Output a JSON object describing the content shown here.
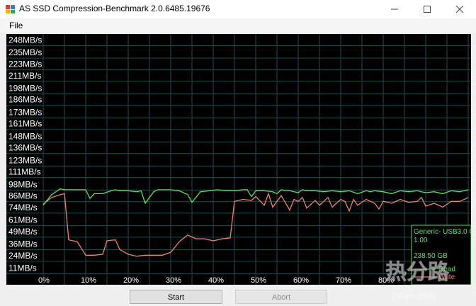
{
  "window": {
    "title": "AS SSD Compression-Benchmark 2.0.6485.19676",
    "minimize_icon": "minimize-icon",
    "maximize_icon": "maximize-icon",
    "close_icon": "close-icon"
  },
  "menu": {
    "file_label": "File"
  },
  "chart_data": {
    "type": "line",
    "title": "",
    "xlabel": "",
    "ylabel": "",
    "y_tick_labels": [
      "248MB/s",
      "235MB/s",
      "223MB/s",
      "211MB/s",
      "198MB/s",
      "186MB/s",
      "173MB/s",
      "161MB/s",
      "148MB/s",
      "136MB/s",
      "123MB/s",
      "111MB/s",
      "98MB/s",
      "86MB/s",
      "74MB/s",
      "61MB/s",
      "49MB/s",
      "36MB/s",
      "24MB/s",
      "11MB/s"
    ],
    "y_ticks": [
      248,
      235,
      223,
      211,
      198,
      186,
      173,
      161,
      148,
      136,
      123,
      111,
      98,
      86,
      74,
      61,
      49,
      36,
      24,
      11
    ],
    "x_tick_labels": [
      "0%",
      "10%",
      "20%",
      "30%",
      "40%",
      "50%",
      "60%",
      "70%",
      "80%",
      "90%",
      "100%"
    ],
    "xlim": [
      0,
      100
    ],
    "ylim": [
      0,
      260
    ],
    "grid": true,
    "series": [
      {
        "name": "Write",
        "color": "#f08070",
        "x": [
          0,
          2,
          4,
          5,
          6,
          8,
          10,
          12,
          14,
          15,
          17,
          18,
          20,
          22,
          24,
          26,
          28,
          30,
          32,
          34,
          36,
          38,
          40,
          42,
          44,
          45,
          47,
          49,
          50,
          52,
          53,
          54,
          56,
          58,
          59,
          60,
          61,
          62,
          64,
          65,
          67,
          68,
          70,
          71,
          72,
          73,
          74,
          76,
          78,
          79,
          80,
          82,
          84,
          86,
          88,
          89,
          90,
          92,
          94,
          96,
          98,
          100
        ],
        "y": [
          77,
          84,
          87,
          88,
          40,
          38,
          24,
          24,
          25,
          39,
          40,
          30,
          25,
          23,
          24,
          24,
          24,
          27,
          38,
          45,
          41,
          41,
          39,
          41,
          42,
          80,
          82,
          81,
          85,
          76,
          88,
          74,
          86,
          71,
          82,
          80,
          84,
          73,
          81,
          76,
          84,
          74,
          82,
          80,
          70,
          82,
          76,
          82,
          78,
          72,
          80,
          78,
          82,
          79,
          80,
          84,
          75,
          78,
          74,
          80,
          80,
          84
        ]
      },
      {
        "name": "Read",
        "color": "#5ee05e",
        "x": [
          0,
          2,
          4,
          5,
          7,
          10,
          11,
          12,
          14,
          16,
          17,
          18,
          20,
          22,
          23,
          24,
          26,
          27,
          28,
          30,
          32,
          34,
          35,
          37,
          39,
          41,
          43,
          45,
          47,
          48,
          49,
          50,
          52,
          54,
          55,
          56,
          58,
          60,
          61,
          62,
          64,
          66,
          68,
          70,
          72,
          74,
          76,
          77,
          78,
          80,
          82,
          84,
          86,
          88,
          89,
          90,
          92,
          94,
          96,
          98,
          100
        ],
        "y": [
          76,
          87,
          93,
          92,
          92,
          92,
          83,
          88,
          88,
          91,
          92,
          91,
          91,
          90,
          91,
          78,
          90,
          92,
          92,
          92,
          91,
          87,
          79,
          90,
          91,
          92,
          91,
          91,
          92,
          92,
          85,
          91,
          91,
          90,
          88,
          92,
          91,
          89,
          92,
          91,
          91,
          90,
          91,
          90,
          91,
          88,
          91,
          90,
          91,
          90,
          88,
          91,
          90,
          91,
          90,
          89,
          90,
          88,
          91,
          90,
          92
        ]
      }
    ],
    "info_box": {
      "device": "Generic- USB3.0 CF",
      "firmware": "1.00",
      "capacity": "238.50 GB",
      "read_label": "Read",
      "write_label": "Write"
    }
  },
  "buttons": {
    "start_label": "Start",
    "abort_label": "Abort"
  },
  "watermark": {
    "logo_text": "热分路",
    "url": "rafuiu.com"
  }
}
